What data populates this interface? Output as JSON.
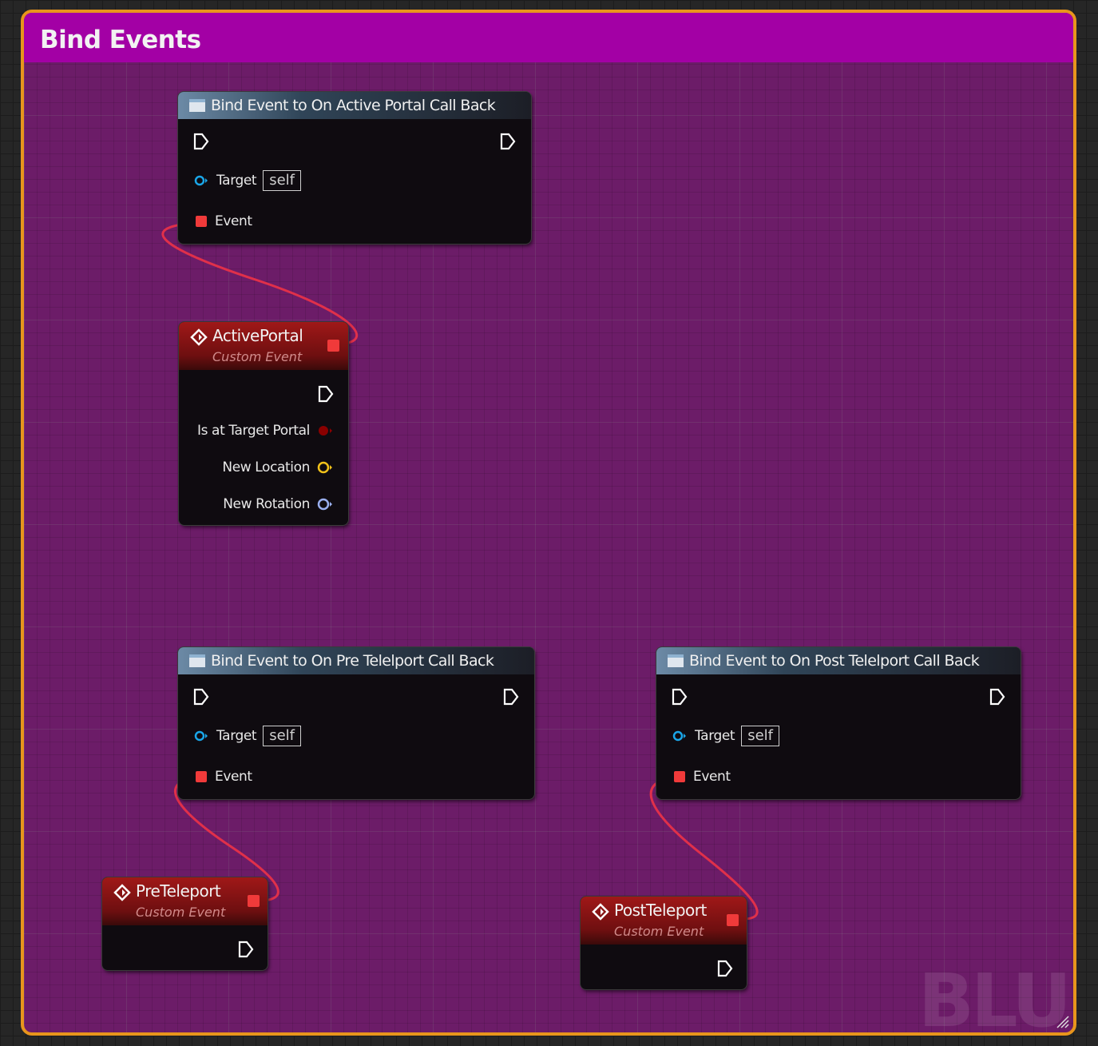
{
  "comment": {
    "title": "Bind Events",
    "watermark": "BLU",
    "color": "#a300a5",
    "border_color": "#e8951c"
  },
  "nodes": {
    "bind_active": {
      "title": "Bind Event to On Active Portal Call Back",
      "target_label": "Target",
      "target_value": "self",
      "event_label": "Event"
    },
    "active_portal": {
      "title": "ActivePortal",
      "subtitle": "Custom Event",
      "outputs": [
        "Is at Target Portal",
        "New Location",
        "New Rotation"
      ]
    },
    "bind_pre": {
      "title": "Bind Event to On Pre Telelport Call Back",
      "target_label": "Target",
      "target_value": "self",
      "event_label": "Event"
    },
    "bind_post": {
      "title": "Bind Event to On Post Telelport Call Back",
      "target_label": "Target",
      "target_value": "self",
      "event_label": "Event"
    },
    "pre_teleport": {
      "title": "PreTeleport",
      "subtitle": "Custom Event"
    },
    "post_teleport": {
      "title": "PostTeleport",
      "subtitle": "Custom Event"
    }
  },
  "pin_colors": {
    "delegate": "#f03a3a",
    "object": "#1aa6e8",
    "bool": "#8a0000",
    "vector": "#f2c21a",
    "rotator": "#9ab0f0",
    "exec": "#ffffff",
    "wire": "#e0304a"
  }
}
